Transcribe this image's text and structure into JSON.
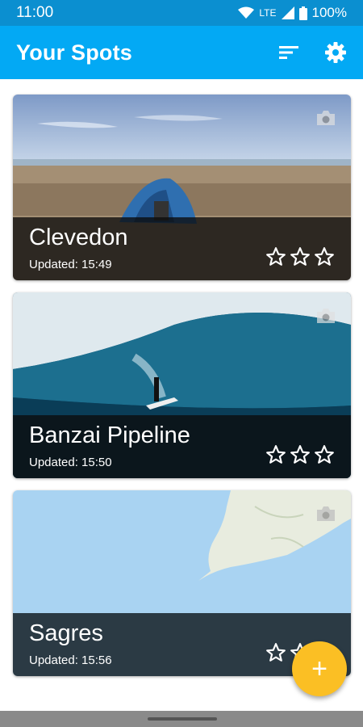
{
  "status_bar": {
    "time": "11:00",
    "network": "LTE",
    "battery": "100%"
  },
  "app_bar": {
    "title": "Your Spots",
    "icons": [
      "sort-icon",
      "settings-gear-icon"
    ]
  },
  "spots": [
    {
      "name": "Clevedon",
      "updated": "Updated: 15:49",
      "rating": 0,
      "max_rating": 3,
      "image": "beach-tent-photo"
    },
    {
      "name": "Banzai Pipeline",
      "updated": "Updated: 15:50",
      "rating": 0,
      "max_rating": 3,
      "image": "surfing-wave-photo"
    },
    {
      "name": "Sagres",
      "updated": "Updated: 15:56",
      "rating": 0,
      "max_rating": 3,
      "image": "map-photo"
    }
  ],
  "fab": {
    "icon": "add-icon",
    "label": "+"
  },
  "colors": {
    "status_bar": "#0b8fd0",
    "app_bar": "#03a9f4",
    "fab": "#fbbf24"
  }
}
